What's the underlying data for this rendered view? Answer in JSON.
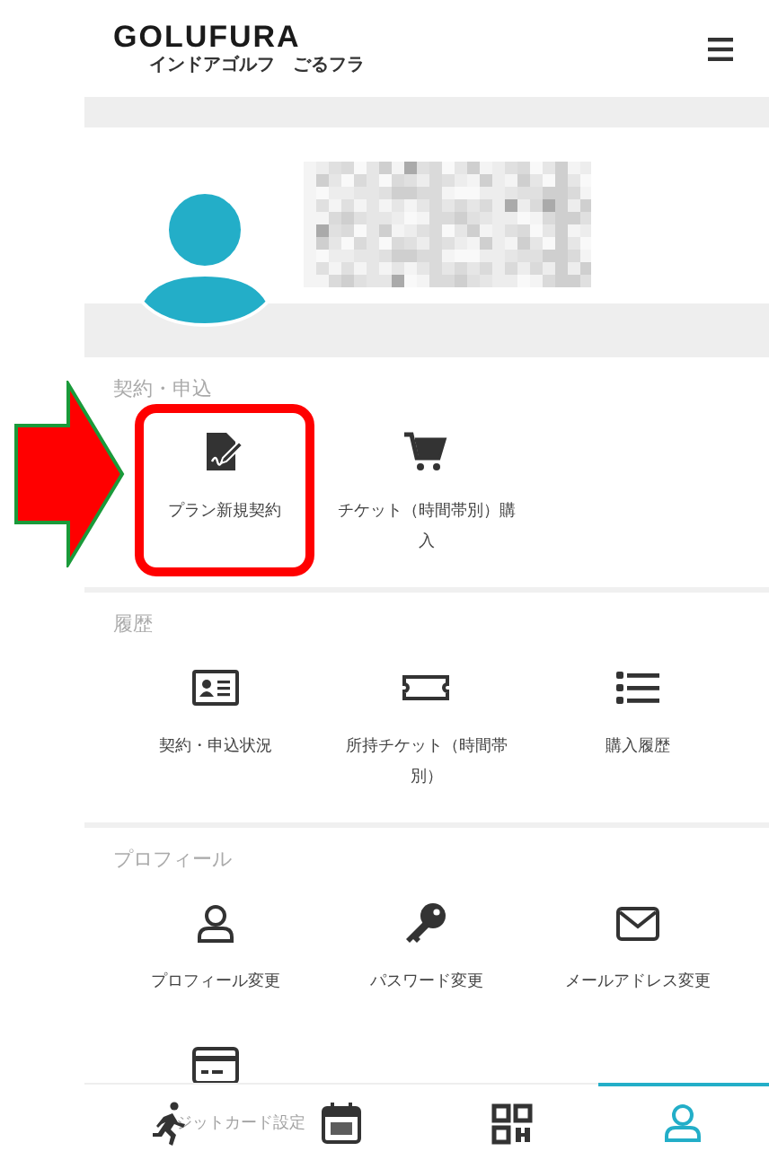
{
  "header": {
    "logo": "GOLUFURA",
    "tagline": "インドアゴルフ　ごるフラ"
  },
  "sections": [
    {
      "title": "契約・申込",
      "items": [
        {
          "kind": "contract",
          "label": "プラン新規契約",
          "highlighted": true
        },
        {
          "kind": "cart",
          "label": "チケット（時間帯別）購入",
          "highlighted": false
        }
      ]
    },
    {
      "title": "履歴",
      "items": [
        {
          "kind": "idcard",
          "label": "契約・申込状況",
          "highlighted": false
        },
        {
          "kind": "ticket",
          "label": "所持チケット（時間帯別）",
          "highlighted": false
        },
        {
          "kind": "list",
          "label": "購入履歴",
          "highlighted": false
        }
      ]
    },
    {
      "title": "プロフィール",
      "items": [
        {
          "kind": "user",
          "label": "プロフィール変更",
          "highlighted": false
        },
        {
          "kind": "key",
          "label": "パスワード変更",
          "highlighted": false
        },
        {
          "kind": "mail",
          "label": "メールアドレス変更",
          "highlighted": false
        },
        {
          "kind": "card",
          "label": "ジットカード設定",
          "highlighted": false
        }
      ]
    }
  ],
  "bottom_nav": [
    {
      "kind": "run",
      "selected": false
    },
    {
      "kind": "calendar",
      "selected": false
    },
    {
      "kind": "qr",
      "selected": false
    },
    {
      "kind": "user",
      "selected": true
    }
  ]
}
